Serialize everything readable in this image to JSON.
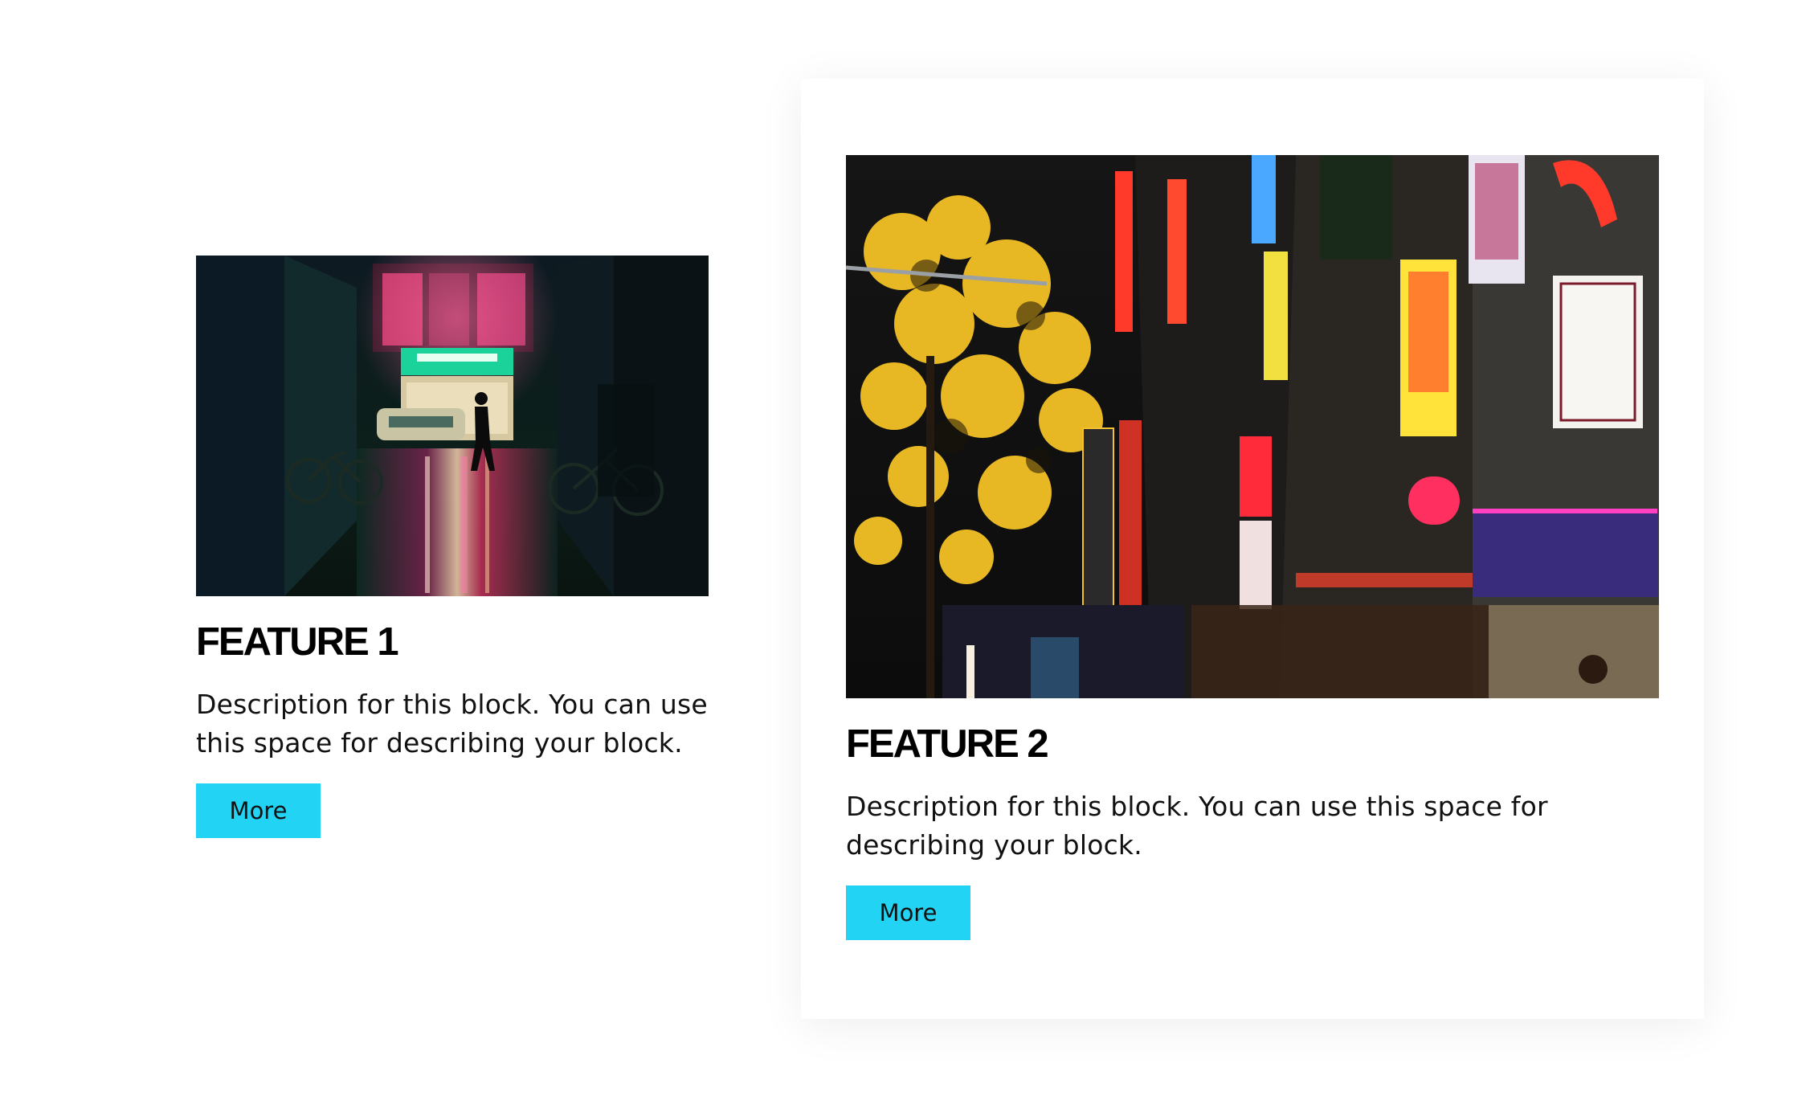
{
  "features": [
    {
      "title": "FEATURE 1",
      "description": "Description for this block. You can use this space for describing your block.",
      "button_label": "More",
      "image_alt": "Neon-lit rainy street at night with bicycles and a storefront"
    },
    {
      "title": "FEATURE 2",
      "description": "Description for this block. You can use this space for describing your block.",
      "button_label": "More",
      "image_alt": "Busy city street at night lined with colorful neon signs and a yellow-leaved tree"
    }
  ],
  "colors": {
    "button": "#22d3f4",
    "title": "#000000",
    "text": "#111111",
    "background": "#ffffff"
  }
}
